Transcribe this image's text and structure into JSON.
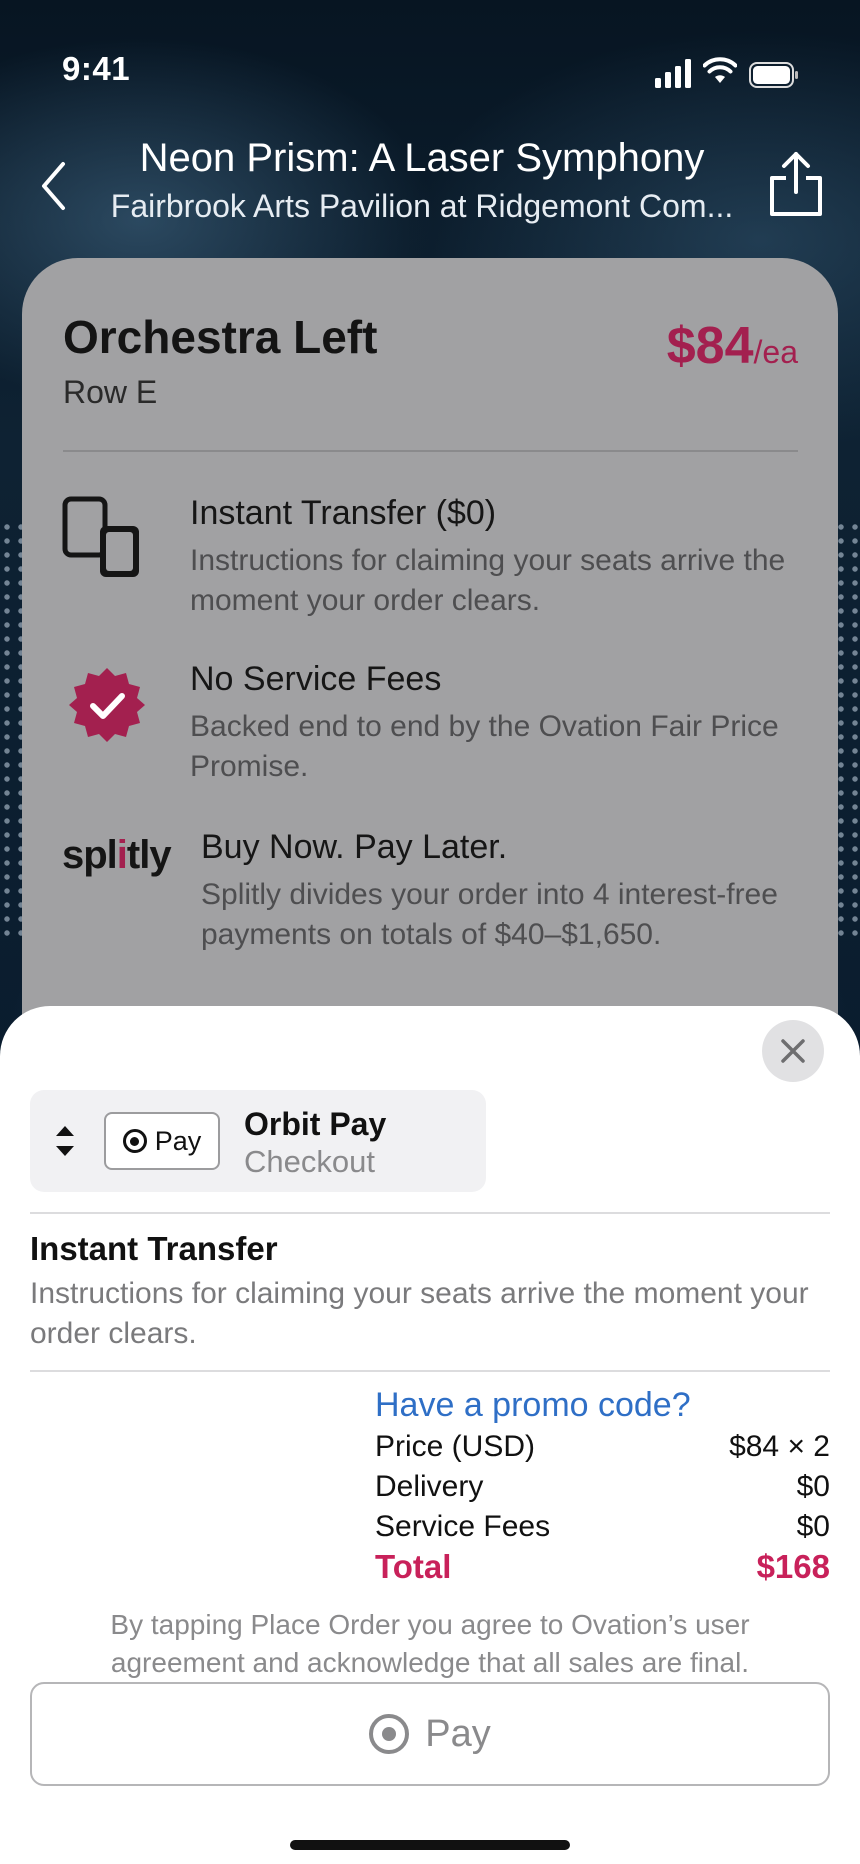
{
  "status_bar": {
    "time": "9:41",
    "signal_icon": "cellular-signal-icon",
    "wifi_icon": "wifi-icon",
    "battery_icon": "battery-icon"
  },
  "header": {
    "title": "Neon Prism: A Laser Symphony",
    "subtitle": "Fairbrook Arts Pavilion at Ridgemont Com...",
    "back_icon": "chevron-left-icon",
    "share_icon": "share-icon"
  },
  "listing": {
    "section": "Orchestra Left",
    "row": "Row E",
    "price": "$84",
    "price_unit": "/ea",
    "accent_color": "#a3204f",
    "features": [
      {
        "icon": "devices-icon",
        "title": "Instant Transfer ($0)",
        "description": "Instructions for claiming your seats arrive the moment your order clears."
      },
      {
        "icon": "verified-badge-icon",
        "title": "No Service Fees",
        "description": "Backed end to end by the Ovation Fair Price Promise."
      },
      {
        "icon": "splitly-logo",
        "logo_text": "splitly",
        "title": "Buy Now. Pay Later.",
        "description": "Splitly divides your order into 4 interest-free payments on totals of $40–$1,650."
      }
    ]
  },
  "sheet": {
    "close_icon": "close-icon",
    "payment_method": {
      "chip_label": "Pay",
      "name": "Orbit Pay",
      "subtitle": "Checkout",
      "selector_icon": "up-down-chevron-icon"
    },
    "delivery": {
      "title": "Instant Transfer",
      "description": "Instructions for claiming your seats arrive the moment your order clears."
    },
    "promo_link": "Have a promo code?",
    "summary": [
      {
        "label": "Price (USD)",
        "value": "$84 × 2"
      },
      {
        "label": "Delivery",
        "value": "$0"
      },
      {
        "label": "Service Fees",
        "value": "$0"
      }
    ],
    "total": {
      "label": "Total",
      "value": "$168"
    },
    "legal": "By tapping Place Order you agree to Ovation’s user agreement and acknowledge that all sales are final.",
    "pay_button_label": "Pay",
    "total_color": "#c8215a",
    "link_color": "#2f6fc6"
  }
}
